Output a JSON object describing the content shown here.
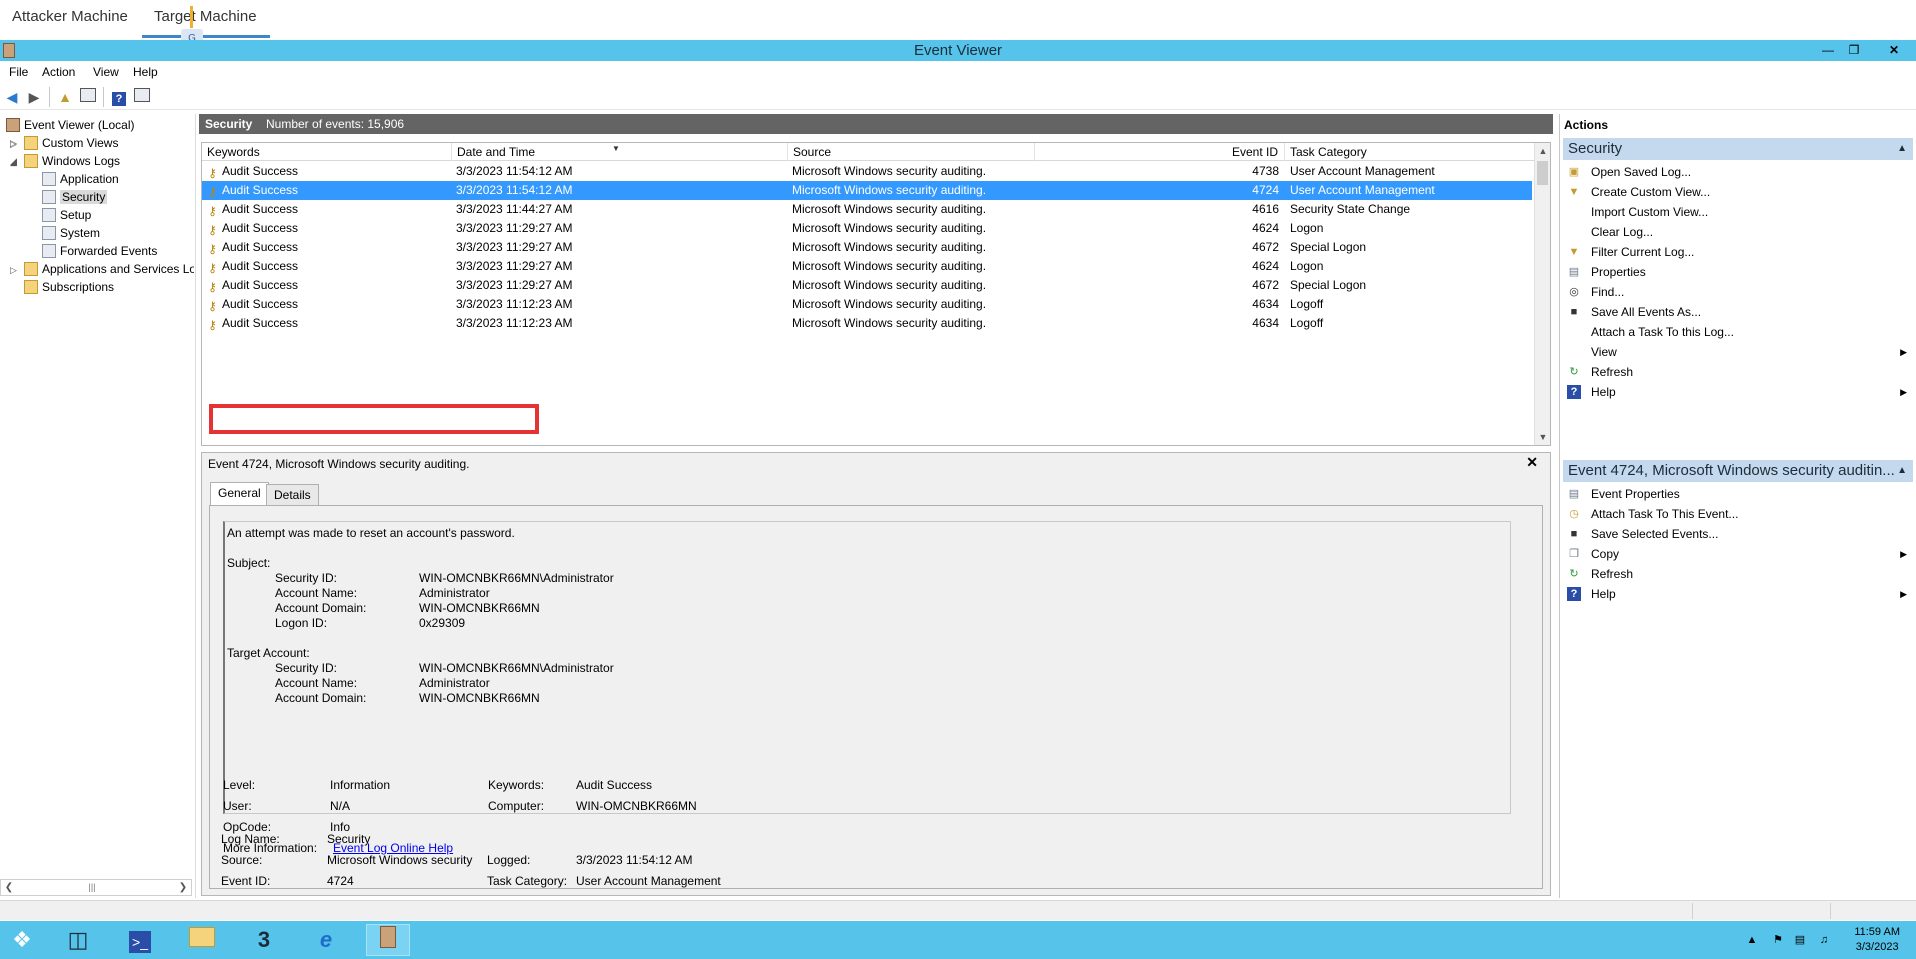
{
  "vm_tabs": [
    {
      "label": "Attacker Machine"
    },
    {
      "label": "Target Machine"
    }
  ],
  "window": {
    "title": "Event Viewer"
  },
  "menu": [
    "File",
    "Action",
    "View",
    "Help"
  ],
  "tree": {
    "root": "Event Viewer (Local)",
    "custom_views": "Custom Views",
    "windows_logs": "Windows Logs",
    "application": "Application",
    "security": "Security",
    "setup": "Setup",
    "system": "System",
    "forwarded_events": "Forwarded Events",
    "apps_services": "Applications and Services Lo",
    "subscriptions": "Subscriptions"
  },
  "log_header": {
    "name": "Security",
    "count": "Number of events: 15,906"
  },
  "grid": {
    "columns": [
      "Keywords",
      "Date and Time",
      "Source",
      "Event ID",
      "Task Category"
    ],
    "rows": [
      {
        "keywords": "Audit Success",
        "date": "3/3/2023 11:54:12 AM",
        "source": "Microsoft Windows security auditing.",
        "event_id": "4738",
        "category": "User Account Management"
      },
      {
        "keywords": "Audit Success",
        "date": "3/3/2023 11:54:12 AM",
        "source": "Microsoft Windows security auditing.",
        "event_id": "4724",
        "category": "User Account Management"
      },
      {
        "keywords": "Audit Success",
        "date": "3/3/2023 11:44:27 AM",
        "source": "Microsoft Windows security auditing.",
        "event_id": "4616",
        "category": "Security State Change"
      },
      {
        "keywords": "Audit Success",
        "date": "3/3/2023 11:29:27 AM",
        "source": "Microsoft Windows security auditing.",
        "event_id": "4624",
        "category": "Logon"
      },
      {
        "keywords": "Audit Success",
        "date": "3/3/2023 11:29:27 AM",
        "source": "Microsoft Windows security auditing.",
        "event_id": "4672",
        "category": "Special Logon"
      },
      {
        "keywords": "Audit Success",
        "date": "3/3/2023 11:29:27 AM",
        "source": "Microsoft Windows security auditing.",
        "event_id": "4624",
        "category": "Logon"
      },
      {
        "keywords": "Audit Success",
        "date": "3/3/2023 11:29:27 AM",
        "source": "Microsoft Windows security auditing.",
        "event_id": "4672",
        "category": "Special Logon"
      },
      {
        "keywords": "Audit Success",
        "date": "3/3/2023 11:12:23 AM",
        "source": "Microsoft Windows security auditing.",
        "event_id": "4634",
        "category": "Logoff"
      },
      {
        "keywords": "Audit Success",
        "date": "3/3/2023 11:12:23 AM",
        "source": "Microsoft Windows security auditing.",
        "event_id": "4634",
        "category": "Logoff"
      }
    ]
  },
  "detail": {
    "title": "Event 4724, Microsoft Windows security auditing.",
    "tab_general": "General",
    "tab_details": "Details",
    "message": {
      "headline": "An attempt was made to reset an account's password.",
      "subject_label": "Subject:",
      "subject": [
        {
          "k": "Security ID:",
          "v": "WIN-OMCNBKR66MN\\Administrator"
        },
        {
          "k": "Account Name:",
          "v": "Administrator"
        },
        {
          "k": "Account Domain:",
          "v": "WIN-OMCNBKR66MN"
        },
        {
          "k": "Logon ID:",
          "v": "0x29309"
        }
      ],
      "target_label": "Target Account:",
      "target": [
        {
          "k": "Security ID:",
          "v": "WIN-OMCNBKR66MN\\Administrator"
        },
        {
          "k": "Account Name:",
          "v": "Administrator"
        },
        {
          "k": "Account Domain:",
          "v": "WIN-OMCNBKR66MN"
        }
      ]
    },
    "props": {
      "log_name_k": "Log Name:",
      "log_name_v": "Security",
      "source_k": "Source:",
      "source_v": "Microsoft Windows security",
      "logged_k": "Logged:",
      "logged_v": "3/3/2023 11:54:12 AM",
      "event_id_k": "Event ID:",
      "event_id_v": "4724",
      "task_cat_k": "Task Category:",
      "task_cat_v": "User Account Management",
      "level_k": "Level:",
      "level_v": "Information",
      "keywords_k": "Keywords:",
      "keywords_v": "Audit Success",
      "user_k": "User:",
      "user_v": "N/A",
      "computer_k": "Computer:",
      "computer_v": "WIN-OMCNBKR66MN",
      "opcode_k": "OpCode:",
      "opcode_v": "Info",
      "more_info_k": "More Information:",
      "more_info_link": "Event Log Online Help"
    }
  },
  "actions": {
    "title": "Actions",
    "group1": "Security",
    "group1_items": [
      {
        "label": "Open Saved Log...",
        "icon": "folder-open-icon"
      },
      {
        "label": "Create Custom View...",
        "icon": "filter-icon"
      },
      {
        "label": "Import Custom View...",
        "icon": ""
      },
      {
        "label": "Clear Log...",
        "icon": ""
      },
      {
        "label": "Filter Current Log...",
        "icon": "filter-icon"
      },
      {
        "label": "Properties",
        "icon": "properties-icon"
      },
      {
        "label": "Find...",
        "icon": "binoculars-icon"
      },
      {
        "label": "Save All Events As...",
        "icon": "save-icon"
      },
      {
        "label": "Attach a Task To this Log...",
        "icon": ""
      },
      {
        "label": "View",
        "icon": ""
      },
      {
        "label": "Refresh",
        "icon": "refresh-icon"
      },
      {
        "label": "Help",
        "icon": "help-icon"
      }
    ],
    "group2": "Event 4724, Microsoft Windows security auditin...",
    "group2_items": [
      {
        "label": "Event Properties",
        "icon": "properties-icon"
      },
      {
        "label": "Attach Task To This Event...",
        "icon": "task-icon"
      },
      {
        "label": "Save Selected Events...",
        "icon": "save-icon"
      },
      {
        "label": "Copy",
        "icon": "copy-icon"
      },
      {
        "label": "Refresh",
        "icon": "refresh-icon"
      },
      {
        "label": "Help",
        "icon": "help-icon"
      }
    ]
  },
  "taskbar": {
    "time": "11:59 AM",
    "date": "3/3/2023"
  },
  "colors": {
    "titlebar": "#56c3ea",
    "selection": "#3399ff",
    "highlight_box": "#e53333",
    "action_group": "#c4d8ee"
  }
}
